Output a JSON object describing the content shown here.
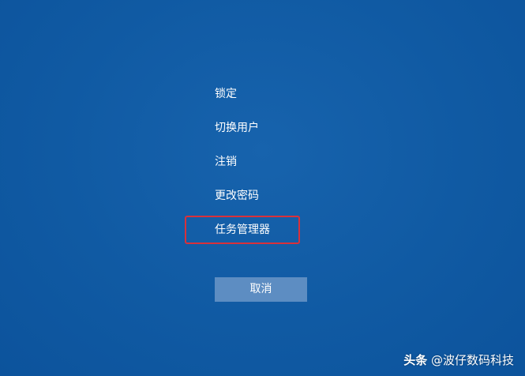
{
  "menu": {
    "items": [
      {
        "label": "锁定"
      },
      {
        "label": "切换用户"
      },
      {
        "label": "注销"
      },
      {
        "label": "更改密码"
      },
      {
        "label": "任务管理器"
      }
    ]
  },
  "cancel_label": "取消",
  "watermark": {
    "brand": "头条",
    "handle": "@波仔数码科技"
  },
  "colors": {
    "background": "#0f5aa4",
    "highlight_border": "#d9313a",
    "cancel_button": "#5d8dc2"
  }
}
